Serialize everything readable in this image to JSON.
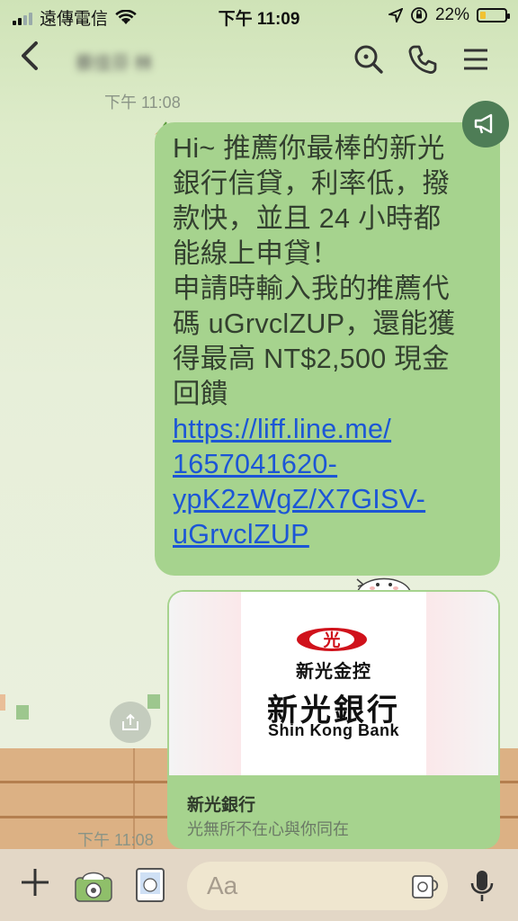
{
  "status_bar": {
    "carrier": "遠傳電信",
    "time": "下午 11:09",
    "battery": "22%",
    "battery_level": 0.22
  },
  "header": {
    "chat_title": "蔡佳芬 林"
  },
  "messages": {
    "time_top": "下午 11:08",
    "bubble_text": "Hi~ 推薦你最棒的新光\n銀行信貸，利率低，撥\n款快，並且 24 小時都\n能線上申貸！\n申請時輸入我的推薦代\n碼 uGrvclZUP，還能獲\n得最高 NT$2,500 現金\n回饋",
    "link_text": "https://liff.line.me/\n1657041620-\nypK2zWgZ/X7GISV-\nuGrvclZUP",
    "time_bottom": "下午 11:08"
  },
  "card": {
    "logo_mark": "光",
    "logo_sub": "新光金控",
    "logo_main": "新光銀行",
    "logo_en": "Shin Kong Bank",
    "title": "新光銀行",
    "subtitle": "光無所不在心與你同在"
  },
  "input": {
    "placeholder": "Aa"
  },
  "colors": {
    "bubble": "#a6d38e",
    "link": "#1c56d6",
    "logo_red": "#d0121b"
  }
}
